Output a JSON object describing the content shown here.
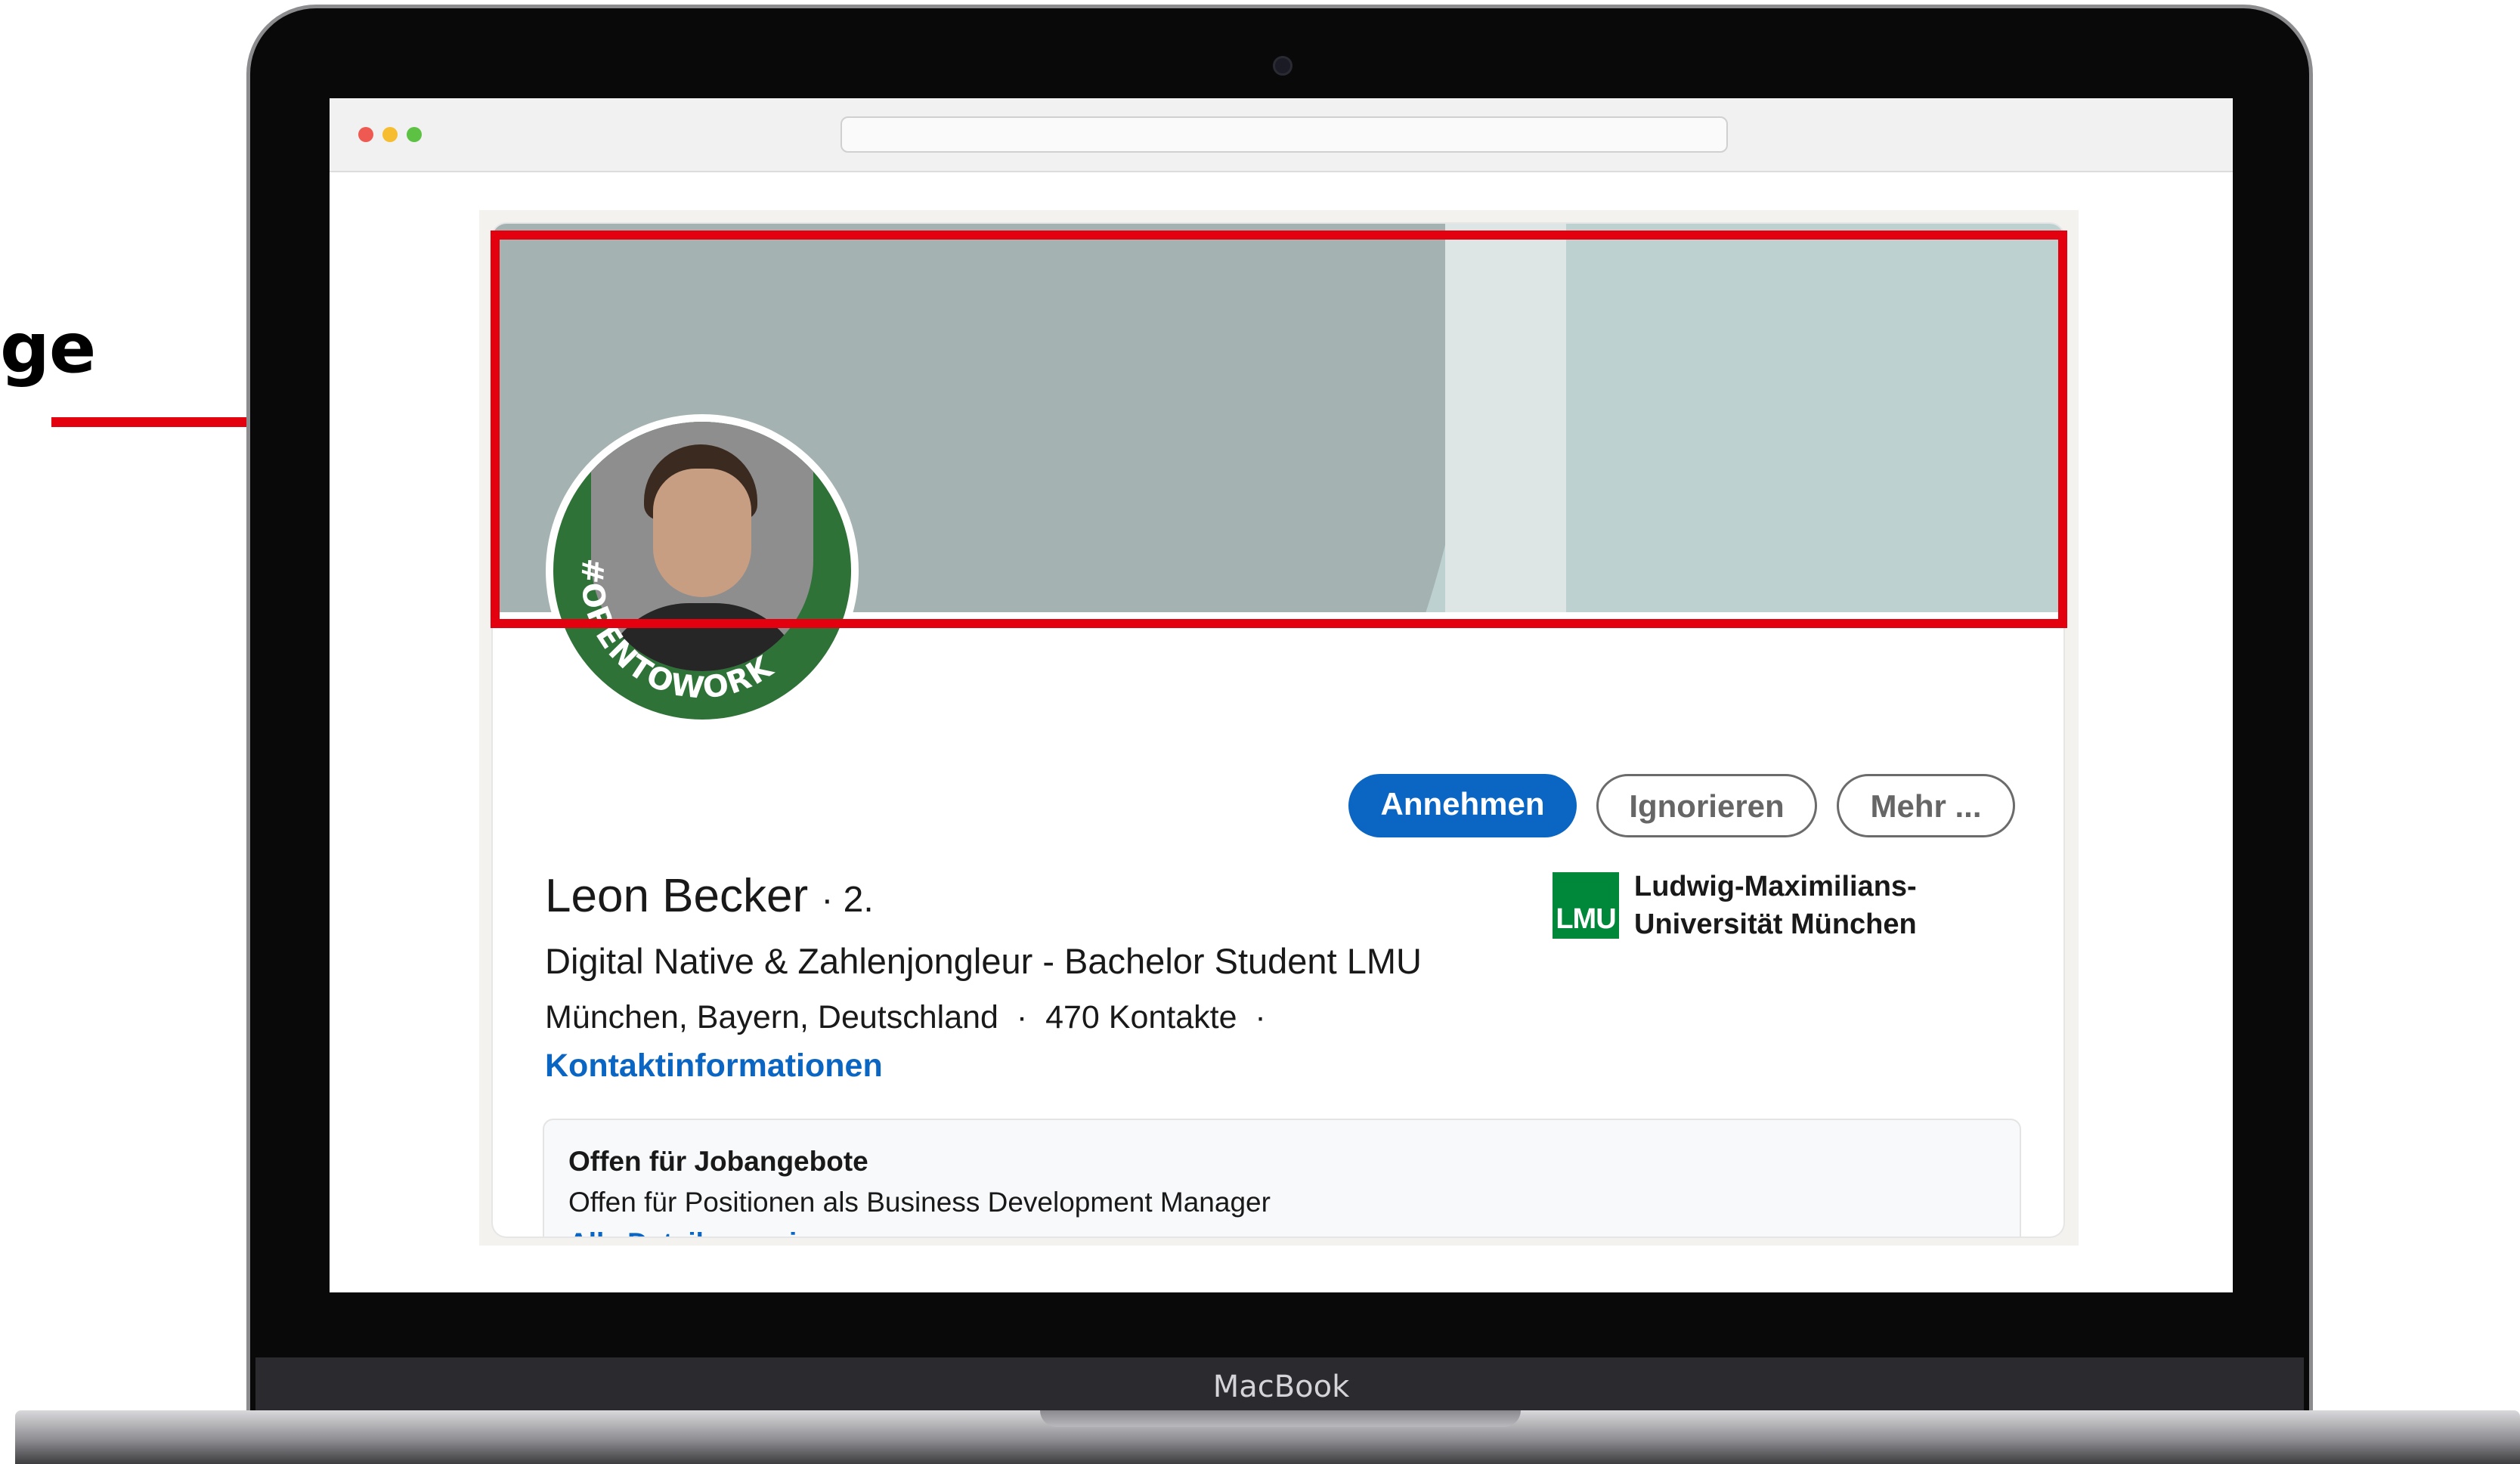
{
  "callout": {
    "text": "ge"
  },
  "device": {
    "label": "MacBook"
  },
  "profile": {
    "badge_text": "#OPENTOWORK",
    "name": "Leon Becker",
    "degree": "· 2.",
    "headline": "Digital Native & Zahlenjongleur - Bachelor Student LMU",
    "location": "München, Bayern, Deutschland",
    "connections": "470 Kontakte",
    "contact_link": "Kontaktinformationen"
  },
  "actions": {
    "accept": "Annehmen",
    "ignore": "Ignorieren",
    "more": "Mehr ..."
  },
  "education": {
    "logo_text": "LMU",
    "school_line1": "Ludwig-Maximilians-",
    "school_line2": "Universität München"
  },
  "open_to_work": {
    "title": "Offen für Jobangebote",
    "description": "Offen für Positionen als Business Development Manager",
    "link": "Alle Details anzeigen"
  },
  "colors": {
    "highlight": "#e3000f",
    "linkedin_blue": "#0a66c2",
    "open_to_work_green": "#2f7238"
  },
  "icons": [
    "camera-icon",
    "window-close-dot-icon",
    "window-minimize-dot-icon",
    "window-maximize-dot-icon"
  ]
}
